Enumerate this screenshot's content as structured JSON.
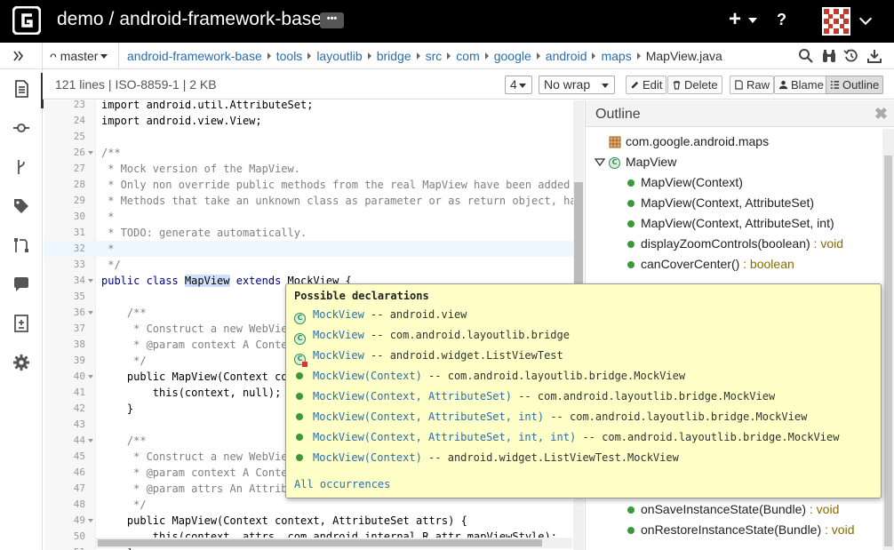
{
  "topbar": {
    "repo_owner": "demo",
    "separator": "/",
    "repo_name": "android-framework-base",
    "more_label": "•••",
    "plus_label": "+",
    "help_label": "?"
  },
  "breadcrumb": {
    "branch": "master",
    "branch_icon": "ᴖ",
    "items": [
      "android-framework-base",
      "tools",
      "layoutlib",
      "bridge",
      "src",
      "com",
      "google",
      "android",
      "maps"
    ],
    "current": "MapView.java"
  },
  "fileinfo": {
    "text": "121 lines | ISO-8859-1 | 2 KB",
    "tab_size": "4",
    "wrap": "No wrap",
    "edit_label": "Edit",
    "delete_label": "Delete",
    "raw_label": "Raw",
    "blame_label": "Blame",
    "outline_label": "Outline"
  },
  "code": {
    "lines": [
      {
        "n": "23",
        "text": "import android.util.AttributeSet;",
        "fold": false
      },
      {
        "n": "24",
        "text": "import android.view.View;",
        "fold": false
      },
      {
        "n": "25",
        "text": "",
        "fold": false
      },
      {
        "n": "26",
        "text": "/**",
        "fold": true,
        "cls": "cm"
      },
      {
        "n": "27",
        "text": " * Mock version of the MapView.",
        "fold": false,
        "cls": "cm"
      },
      {
        "n": "28",
        "text": " * Only non override public methods from the real MapView have been added t",
        "fold": false,
        "cls": "cm"
      },
      {
        "n": "29",
        "text": " * Methods that take an unknown class as parameter or as return object, hav",
        "fold": false,
        "cls": "cm"
      },
      {
        "n": "30",
        "text": " *",
        "fold": false,
        "cls": "cm"
      },
      {
        "n": "31",
        "text": " * TODO: generate automatically.",
        "fold": false,
        "cls": "cm"
      },
      {
        "n": "32",
        "text": " *",
        "fold": false,
        "cls": "cm",
        "cur": true
      },
      {
        "n": "33",
        "text": " */",
        "fold": false,
        "cls": "cm"
      },
      {
        "n": "34",
        "text": "",
        "fold": true,
        "special": "classdecl"
      },
      {
        "n": "35",
        "text": "",
        "fold": false
      },
      {
        "n": "36",
        "text": "    /**",
        "fold": true,
        "cls": "cm"
      },
      {
        "n": "37",
        "text": "     * Construct a new WebVie",
        "fold": false,
        "cls": "cm"
      },
      {
        "n": "38",
        "text": "     * @param context A Conte",
        "fold": false,
        "cls": "cm"
      },
      {
        "n": "39",
        "text": "     */",
        "fold": false,
        "cls": "cm"
      },
      {
        "n": "40",
        "text": "    public MapView(Context co",
        "fold": true
      },
      {
        "n": "41",
        "text": "        this(context, null);",
        "fold": false
      },
      {
        "n": "42",
        "text": "    }",
        "fold": false
      },
      {
        "n": "43",
        "text": "",
        "fold": false
      },
      {
        "n": "44",
        "text": "    /**",
        "fold": true,
        "cls": "cm"
      },
      {
        "n": "45",
        "text": "     * Construct a new WebVie",
        "fold": false,
        "cls": "cm"
      },
      {
        "n": "46",
        "text": "     * @param context A Conte",
        "fold": false,
        "cls": "cm"
      },
      {
        "n": "47",
        "text": "     * @param attrs An Attrib",
        "fold": false,
        "cls": "cm"
      },
      {
        "n": "48",
        "text": "     */",
        "fold": false,
        "cls": "cm"
      },
      {
        "n": "49",
        "text": "    public MapView(Context context, AttributeSet attrs) {",
        "fold": true
      },
      {
        "n": "50",
        "text": "        this(context, attrs, com.android.internal.R.attr.mapViewStyle);",
        "fold": false
      },
      {
        "n": "51",
        "text": "    }",
        "fold": false
      }
    ],
    "classdecl": {
      "kw1": "public class ",
      "name": "MapView",
      "kw2": " extends ",
      "rest": "MockView {"
    }
  },
  "outline": {
    "title": "Outline",
    "close": "✖",
    "package": "com.google.android.maps",
    "class_name": "MapView",
    "members": [
      {
        "name": "MapView(Context)",
        "type": ""
      },
      {
        "name": "MapView(Context, AttributeSet)",
        "type": ""
      },
      {
        "name": "MapView(Context, AttributeSet, int)",
        "type": ""
      },
      {
        "name": "displayZoomControls(boolean)",
        "type": " : void"
      },
      {
        "name": "canCoverCenter()",
        "type": " : boolean"
      }
    ],
    "bottom_members": [
      {
        "name": "onSaveInstanceState(Bundle)",
        "type": " : void"
      },
      {
        "name": "onRestoreInstanceState(Bundle)",
        "type": " : void"
      }
    ]
  },
  "popup": {
    "title": "Possible declarations",
    "rows": [
      {
        "kind": "class",
        "name": "MockView",
        "desc": " -- android.view"
      },
      {
        "kind": "class",
        "name": "MockView",
        "desc": " -- com.android.layoutlib.bridge"
      },
      {
        "kind": "class-err",
        "name": "MockView",
        "desc": " -- android.widget.ListViewTest"
      },
      {
        "kind": "method",
        "name": "MockView(Context)",
        "desc": " -- com.android.layoutlib.bridge.MockView"
      },
      {
        "kind": "method",
        "name": "MockView(Context, AttributeSet)",
        "desc": " -- com.android.layoutlib.bridge.MockView"
      },
      {
        "kind": "method",
        "name": "MockView(Context, AttributeSet, int)",
        "desc": " -- com.android.layoutlib.bridge.MockView"
      },
      {
        "kind": "method",
        "name": "MockView(Context, AttributeSet, int, int)",
        "desc": " -- com.android.layoutlib.bridge.MockView"
      },
      {
        "kind": "method",
        "name": "MockView(Context)",
        "desc": " -- android.widget.ListViewTest.MockView"
      }
    ],
    "all_label": "All occurrences"
  },
  "icons": {
    "sidebar": [
      "source-icon",
      "commits-icon",
      "branches-icon",
      "tags-icon",
      "pull-requests-icon",
      "comments-icon",
      "reviews-icon",
      "settings-icon"
    ],
    "colors": {
      "accent": "#2a6db0",
      "popup_bg": "#ffffc8",
      "method_green": "#3a9a3a"
    }
  }
}
